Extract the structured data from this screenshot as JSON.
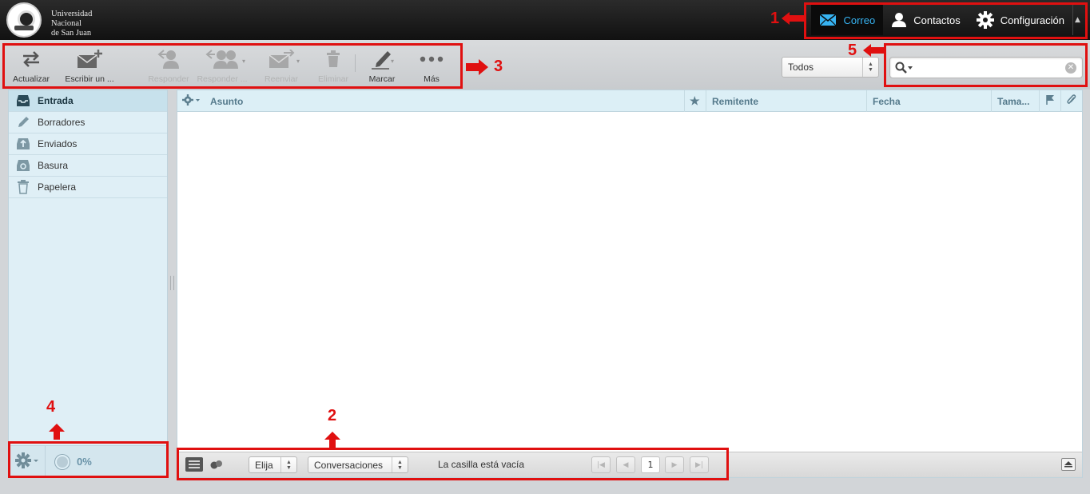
{
  "org": {
    "name_lines": [
      "Universidad",
      "Nacional",
      "de San Juan"
    ]
  },
  "topnav": {
    "items": [
      {
        "label": "Correo",
        "icon": "envelope-icon",
        "active": true
      },
      {
        "label": "Contactos",
        "icon": "person-icon",
        "active": false
      },
      {
        "label": "Configuración",
        "icon": "gear-icon",
        "active": false
      }
    ]
  },
  "toolbar": {
    "refresh_label": "Actualizar",
    "compose_label": "Escribir un ...",
    "reply_label": "Responder",
    "reply_all_label": "Responder ...",
    "forward_label": "Reenviar",
    "delete_label": "Eliminar",
    "mark_label": "Marcar",
    "more_label": "Más"
  },
  "filter": {
    "selected": "Todos"
  },
  "search": {
    "value": "",
    "placeholder": ""
  },
  "folders": [
    {
      "label": "Entrada",
      "icon": "inbox-icon",
      "selected": true
    },
    {
      "label": "Borradores",
      "icon": "pencil-icon",
      "selected": false
    },
    {
      "label": "Enviados",
      "icon": "sent-icon",
      "selected": false
    },
    {
      "label": "Basura",
      "icon": "junk-icon",
      "selected": false
    },
    {
      "label": "Papelera",
      "icon": "trash-icon",
      "selected": false
    }
  ],
  "quota": {
    "text": "0%",
    "value": 0
  },
  "list": {
    "columns": {
      "subject": "Asunto",
      "sender": "Remitente",
      "date": "Fecha",
      "size": "Tama..."
    },
    "rows": []
  },
  "footer": {
    "select_label": "Elija",
    "threads_label": "Conversaciones",
    "empty_text": "La casilla está vacía",
    "page": "1"
  },
  "annotations": [
    "1",
    "2",
    "3",
    "4",
    "5"
  ],
  "colors": {
    "annotation": "#e01010",
    "active_nav": "#37b3f2",
    "sidebar_bg": "#dfeff6"
  }
}
